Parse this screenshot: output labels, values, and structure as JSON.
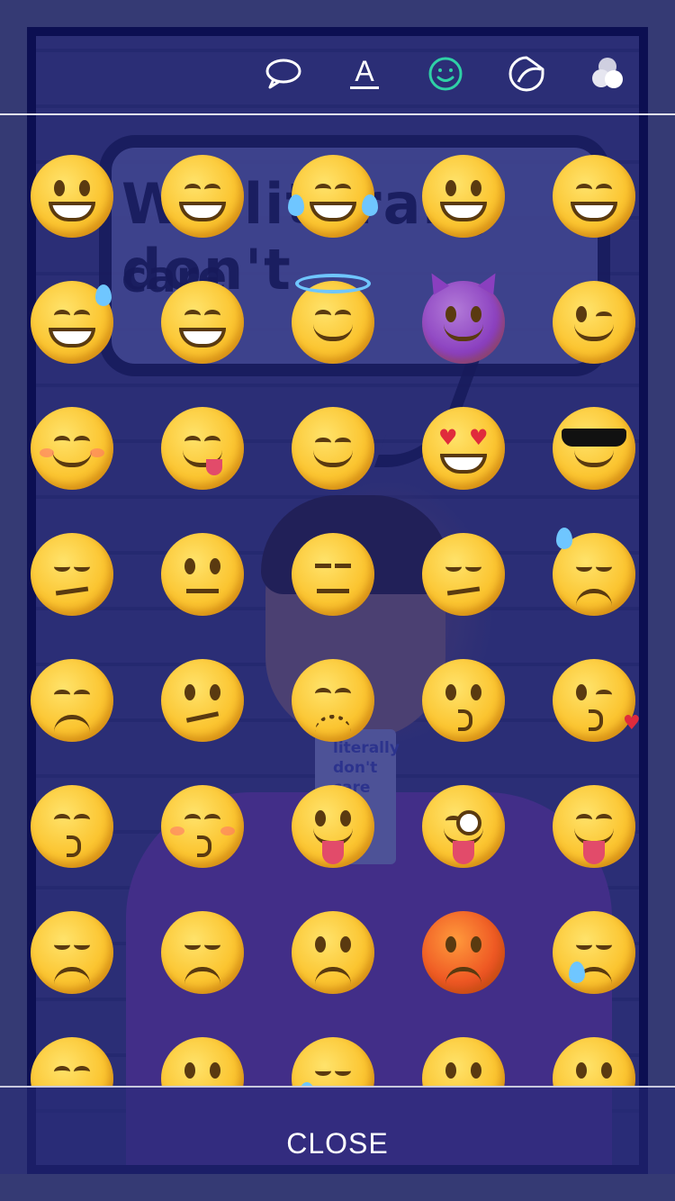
{
  "toolbar": {
    "items": [
      {
        "icon": "speech-bubble-icon",
        "color": "#ffffff",
        "active": false
      },
      {
        "icon": "text-tool-icon",
        "label": "A",
        "color": "#ffffff",
        "active": false
      },
      {
        "icon": "emoji-face-icon",
        "color": "#2fd1a6",
        "active": true
      },
      {
        "icon": "sticker-icon",
        "color": "#ffffff",
        "active": false
      },
      {
        "icon": "color-circles-icon",
        "color": "#ffffff",
        "active": false
      }
    ]
  },
  "background_photo": {
    "bubble_text_line1": "We literally don't",
    "bubble_text_line2": "care",
    "mug_text": [
      "literally",
      "don't",
      "care"
    ]
  },
  "emoji_grid": {
    "rows": [
      [
        "grinning-face",
        "beaming-face",
        "tears-of-joy",
        "grinning-big-eyes",
        "grinning-squinting"
      ],
      [
        "sweat-smile",
        "squinting-laugh",
        "halo-smile",
        "smiling-devil",
        "winking-face"
      ],
      [
        "blushing-smile",
        "yum-face",
        "relieved-face",
        "heart-eyes",
        "sunglasses-face"
      ],
      [
        "smirking-face",
        "neutral-face",
        "expressionless-face",
        "unamused-face",
        "downcast-sweat"
      ],
      [
        "pensive-face",
        "confused-face",
        "confounded-face",
        "kissing-face",
        "kiss-heart-face"
      ],
      [
        "kissing-smiling-eyes",
        "kissing-closed-eyes",
        "tongue-out",
        "winking-tongue",
        "squinting-tongue"
      ],
      [
        "disappointed-face",
        "worried-face",
        "angry-face",
        "pouting-face",
        "crying-face"
      ],
      [
        "persevering-face",
        "triumph-face",
        "sad-sweat",
        "face-partial",
        "upside-partial"
      ]
    ]
  },
  "footer": {
    "close_label": "CLOSE"
  }
}
